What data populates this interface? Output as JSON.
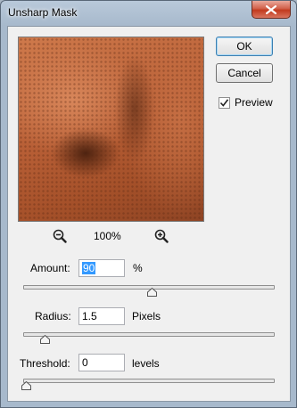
{
  "window": {
    "title": "Unsharp Mask"
  },
  "buttons": {
    "ok": "OK",
    "cancel": "Cancel"
  },
  "preview_toggle": {
    "label": "Preview",
    "checked": true
  },
  "zoom": {
    "level": "100%"
  },
  "amount": {
    "label": "Amount:",
    "value": "90",
    "unit": "%",
    "slider_fraction": 0.5
  },
  "radius": {
    "label": "Radius:",
    "value": "1.5",
    "unit": "Pixels",
    "slider_fraction": 0.075
  },
  "threshold": {
    "label": "Threshold:",
    "value": "0",
    "unit": "levels",
    "slider_fraction": 0.0
  },
  "colors": {
    "close_button": "#c23a1e",
    "selection": "#3399ff"
  }
}
